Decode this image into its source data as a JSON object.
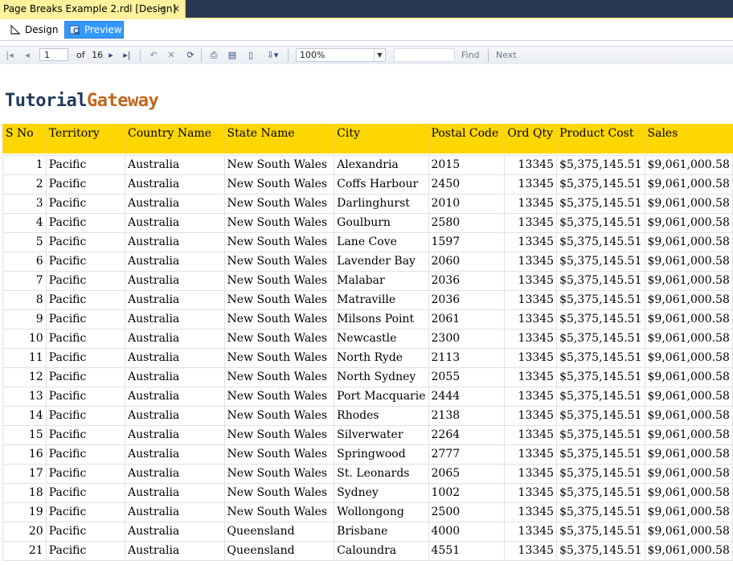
{
  "document_tab": {
    "title": "Page Breaks Example 2.rdl [Design]",
    "pin_glyph": "⊸",
    "close_glyph": "✕"
  },
  "view_tabs": {
    "design": "Design",
    "preview": "Preview"
  },
  "toolbar": {
    "page_input": "1",
    "page_of": "of",
    "page_total": "16",
    "zoom": "100%",
    "find": "Find",
    "next": "Next"
  },
  "logo": {
    "part1": "Tutorial",
    "part2": "Gateway"
  },
  "colors": {
    "header_bg": "#ffd700",
    "logo_dark": "#1f3a5a",
    "logo_orange": "#c0661a",
    "preview_tab": "#3399ff"
  },
  "table": {
    "columns": [
      "S No",
      "Territory",
      "Country Name",
      "State Name",
      "City",
      "Postal Code",
      "Ord Qty",
      "Product Cost",
      "Sales"
    ],
    "rows": [
      [
        "1",
        "Pacific",
        "Australia",
        "New South Wales",
        "Alexandria",
        "2015",
        "13345",
        "$5,375,145.51",
        "$9,061,000.58"
      ],
      [
        "2",
        "Pacific",
        "Australia",
        "New South Wales",
        "Coffs Harbour",
        "2450",
        "13345",
        "$5,375,145.51",
        "$9,061,000.58"
      ],
      [
        "3",
        "Pacific",
        "Australia",
        "New South Wales",
        "Darlinghurst",
        "2010",
        "13345",
        "$5,375,145.51",
        "$9,061,000.58"
      ],
      [
        "4",
        "Pacific",
        "Australia",
        "New South Wales",
        "Goulburn",
        "2580",
        "13345",
        "$5,375,145.51",
        "$9,061,000.58"
      ],
      [
        "5",
        "Pacific",
        "Australia",
        "New South Wales",
        "Lane Cove",
        "1597",
        "13345",
        "$5,375,145.51",
        "$9,061,000.58"
      ],
      [
        "6",
        "Pacific",
        "Australia",
        "New South Wales",
        "Lavender Bay",
        "2060",
        "13345",
        "$5,375,145.51",
        "$9,061,000.58"
      ],
      [
        "7",
        "Pacific",
        "Australia",
        "New South Wales",
        "Malabar",
        "2036",
        "13345",
        "$5,375,145.51",
        "$9,061,000.58"
      ],
      [
        "8",
        "Pacific",
        "Australia",
        "New South Wales",
        "Matraville",
        "2036",
        "13345",
        "$5,375,145.51",
        "$9,061,000.58"
      ],
      [
        "9",
        "Pacific",
        "Australia",
        "New South Wales",
        "Milsons Point",
        "2061",
        "13345",
        "$5,375,145.51",
        "$9,061,000.58"
      ],
      [
        "10",
        "Pacific",
        "Australia",
        "New South Wales",
        "Newcastle",
        "2300",
        "13345",
        "$5,375,145.51",
        "$9,061,000.58"
      ],
      [
        "11",
        "Pacific",
        "Australia",
        "New South Wales",
        "North Ryde",
        "2113",
        "13345",
        "$5,375,145.51",
        "$9,061,000.58"
      ],
      [
        "12",
        "Pacific",
        "Australia",
        "New South Wales",
        "North Sydney",
        "2055",
        "13345",
        "$5,375,145.51",
        "$9,061,000.58"
      ],
      [
        "13",
        "Pacific",
        "Australia",
        "New South Wales",
        "Port Macquarie",
        "2444",
        "13345",
        "$5,375,145.51",
        "$9,061,000.58"
      ],
      [
        "14",
        "Pacific",
        "Australia",
        "New South Wales",
        "Rhodes",
        "2138",
        "13345",
        "$5,375,145.51",
        "$9,061,000.58"
      ],
      [
        "15",
        "Pacific",
        "Australia",
        "New South Wales",
        "Silverwater",
        "2264",
        "13345",
        "$5,375,145.51",
        "$9,061,000.58"
      ],
      [
        "16",
        "Pacific",
        "Australia",
        "New South Wales",
        "Springwood",
        "2777",
        "13345",
        "$5,375,145.51",
        "$9,061,000.58"
      ],
      [
        "17",
        "Pacific",
        "Australia",
        "New South Wales",
        "St. Leonards",
        "2065",
        "13345",
        "$5,375,145.51",
        "$9,061,000.58"
      ],
      [
        "18",
        "Pacific",
        "Australia",
        "New South Wales",
        "Sydney",
        "1002",
        "13345",
        "$5,375,145.51",
        "$9,061,000.58"
      ],
      [
        "19",
        "Pacific",
        "Australia",
        "New South Wales",
        "Wollongong",
        "2500",
        "13345",
        "$5,375,145.51",
        "$9,061,000.58"
      ],
      [
        "20",
        "Pacific",
        "Australia",
        "Queensland",
        "Brisbane",
        "4000",
        "13345",
        "$5,375,145.51",
        "$9,061,000.58"
      ],
      [
        "21",
        "Pacific",
        "Australia",
        "Queensland",
        "Caloundra",
        "4551",
        "13345",
        "$5,375,145.51",
        "$9,061,000.58"
      ]
    ]
  }
}
